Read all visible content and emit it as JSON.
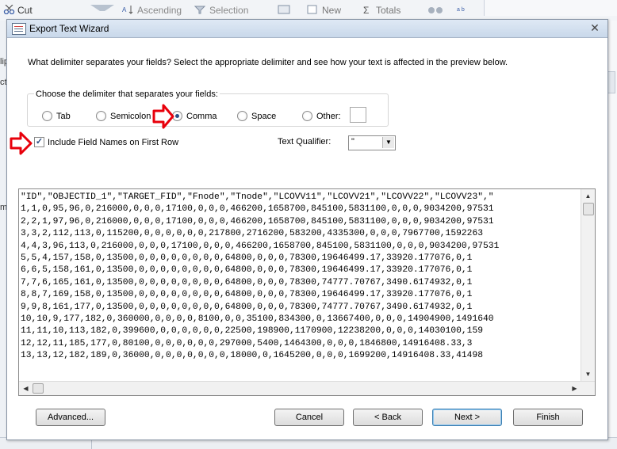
{
  "background": {
    "ribbon": {
      "cut": "Cut",
      "ascending": "Ascending",
      "selection": "Selection",
      "new": "New",
      "totals": "Totals"
    },
    "left_fragments": [
      "lip",
      "ct",
      "ml"
    ]
  },
  "dialog": {
    "title": "Export Text Wizard",
    "intro": "What delimiter separates your fields? Select the appropriate delimiter and see how your text is affected in the preview below.",
    "group_label": "Choose the delimiter that separates your fields:",
    "delimiters": {
      "tab": "Tab",
      "semicolon": "Semicolon",
      "comma": "Comma",
      "space": "Space",
      "other": "Other:"
    },
    "selected_delimiter": "Comma",
    "include_field_names": "Include Field Names on First Row",
    "include_field_names_checked": true,
    "text_qualifier_label": "Text Qualifier:",
    "text_qualifier_value": "\"",
    "preview_lines": [
      "\"ID\",\"OBJECTID_1\",\"TARGET_FID\",\"Fnode\",\"Tnode\",\"LCOVV11\",\"LCOVV21\",\"LCOVV22\",\"LCOVV23\",\"",
      "1,1,0,95,96,0,216000,0,0,0,17100,0,0,0,466200,1658700,845100,5831100,0,0,0,9034200,97531",
      "2,2,1,97,96,0,216000,0,0,0,17100,0,0,0,466200,1658700,845100,5831100,0,0,0,9034200,97531",
      "3,3,2,112,113,0,115200,0,0,0,0,0,0,217800,2716200,583200,4335300,0,0,0,7967700,1592263",
      "4,4,3,96,113,0,216000,0,0,0,17100,0,0,0,466200,1658700,845100,5831100,0,0,0,9034200,97531",
      "5,5,4,157,158,0,13500,0,0,0,0,0,0,0,0,64800,0,0,0,78300,19646499.17,33920.177076,0,1",
      "6,6,5,158,161,0,13500,0,0,0,0,0,0,0,0,64800,0,0,0,78300,19646499.17,33920.177076,0,1",
      "7,7,6,165,161,0,13500,0,0,0,0,0,0,0,0,64800,0,0,0,78300,74777.70767,3490.6174932,0,1",
      "8,8,7,169,158,0,13500,0,0,0,0,0,0,0,0,64800,0,0,0,78300,19646499.17,33920.177076,0,1",
      "9,9,8,161,177,0,13500,0,0,0,0,0,0,0,0,64800,0,0,0,78300,74777.70767,3490.6174932,0,1",
      "10,10,9,177,182,0,360000,0,0,0,0,8100,0,0,35100,834300,0,13667400,0,0,0,14904900,1491640",
      "11,11,10,113,182,0,399600,0,0,0,0,0,0,22500,198900,1170900,12238200,0,0,0,14030100,159",
      "12,12,11,185,177,0,80100,0,0,0,0,0,0,297000,5400,1464300,0,0,0,1846800,14916408.33,3",
      "13,13,12,182,189,0,36000,0,0,0,0,0,0,0,18000,0,1645200,0,0,0,1699200,14916408.33,41498"
    ],
    "buttons": {
      "advanced": "Advanced...",
      "cancel": "Cancel",
      "back": "< Back",
      "next": "Next >",
      "finish": "Finish"
    }
  },
  "colors": {
    "annotation_arrow": "#e8000b",
    "title_bar": "#c9d8ea",
    "primary_button_border": "#3c7fb1"
  },
  "icons": {
    "cut": "scissors-icon",
    "filter": "filter-icon",
    "sort_ascending": "sort-ascending-icon",
    "selection": "selection-filter-icon",
    "new": "new-record-icon",
    "totals": "sigma-icon",
    "find": "binoculars-icon",
    "replace": "replace-icon",
    "title": "wizard-icon",
    "close": "close-icon",
    "dropdown": "chevron-down-icon"
  }
}
